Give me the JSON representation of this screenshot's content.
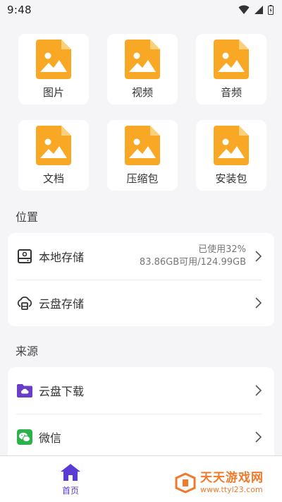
{
  "status_bar": {
    "time": "9:48"
  },
  "categories": [
    {
      "label": "图片",
      "icon": "image-file-icon"
    },
    {
      "label": "视频",
      "icon": "image-file-icon"
    },
    {
      "label": "音频",
      "icon": "image-file-icon"
    },
    {
      "label": "文档",
      "icon": "image-file-icon"
    },
    {
      "label": "压缩包",
      "icon": "image-file-icon"
    },
    {
      "label": "安装包",
      "icon": "image-file-icon"
    }
  ],
  "location_section": {
    "title": "位置",
    "items": [
      {
        "label": "本地存储",
        "icon": "hard-drive-icon",
        "usage": "已使用32%",
        "capacity": "83.86GB可用/124.99GB"
      },
      {
        "label": "云盘存储",
        "icon": "cloud-drive-icon"
      }
    ]
  },
  "source_section": {
    "title": "来源",
    "items": [
      {
        "label": "云盘下载",
        "icon": "cloud-folder-icon"
      },
      {
        "label": "微信",
        "icon": "wechat-icon"
      }
    ]
  },
  "bottom_nav": {
    "home_label": "首页"
  },
  "watermark": {
    "title": "天天游戏网",
    "url": "www.ttyl23.com"
  },
  "colors": {
    "file_icon": "#f9a825",
    "accent": "#5b3bd6",
    "watermark": "#f07a2a"
  }
}
